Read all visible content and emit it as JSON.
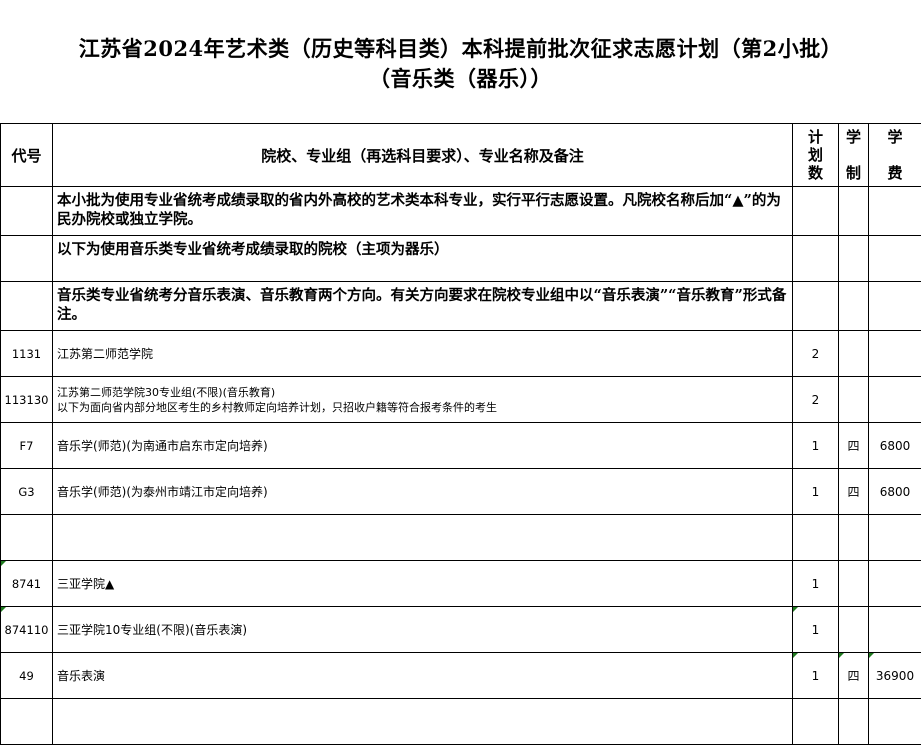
{
  "title": {
    "line1": "江苏省2024年艺术类（历史等科目类）本科提前批次征求志愿计划（第2小批）",
    "line2": "（音乐类（器乐））"
  },
  "header": {
    "code": "代号",
    "name": "院校、专业组（再选科目要求）、专业名称及备注",
    "plan": [
      "计",
      "划",
      "数"
    ],
    "years": [
      "学",
      "制"
    ],
    "fee": [
      "学",
      "费"
    ]
  },
  "notes": {
    "n1": "本小批为使用专业省统考成绩录取的省内外高校的艺术类本科专业，实行平行志愿设置。凡院校名称后加“▲”的为民办院校或独立学院。",
    "n2": "以下为使用音乐类专业省统考成绩录取的院校（主项为器乐）",
    "n3": "音乐类专业省统考分音乐表演、音乐教育两个方向。有关方向要求在院校专业组中以“音乐表演”“音乐教育”形式备注。"
  },
  "rows": [
    {
      "code": "1131",
      "name": "江苏第二师范学院",
      "plan": "2",
      "years": "",
      "fee": ""
    },
    {
      "code": "113130",
      "name": "江苏第二师范学院30专业组(不限)(音乐教育)",
      "remark": "以下为面向省内部分地区考生的乡村教师定向培养计划，只招收户籍等符合报考条件的考生",
      "plan": "2",
      "years": "",
      "fee": ""
    },
    {
      "code": "F7",
      "name": "音乐学(师范)(为南通市启东市定向培养)",
      "plan": "1",
      "years": "四",
      "fee": "6800"
    },
    {
      "code": "G3",
      "name": "音乐学(师范)(为泰州市靖江市定向培养)",
      "plan": "1",
      "years": "四",
      "fee": "6800"
    },
    {
      "code": "",
      "name": "",
      "plan": "",
      "years": "",
      "fee": ""
    },
    {
      "code": "8741",
      "name": "三亚学院▲",
      "plan": "1",
      "years": "",
      "fee": ""
    },
    {
      "code": "874110",
      "name": "三亚学院10专业组(不限)(音乐表演)",
      "plan": "1",
      "years": "",
      "fee": ""
    },
    {
      "code": "49",
      "name": "音乐表演",
      "plan": "1",
      "years": "四",
      "fee": "36900"
    },
    {
      "code": "",
      "name": "",
      "plan": "",
      "years": "",
      "fee": ""
    }
  ]
}
